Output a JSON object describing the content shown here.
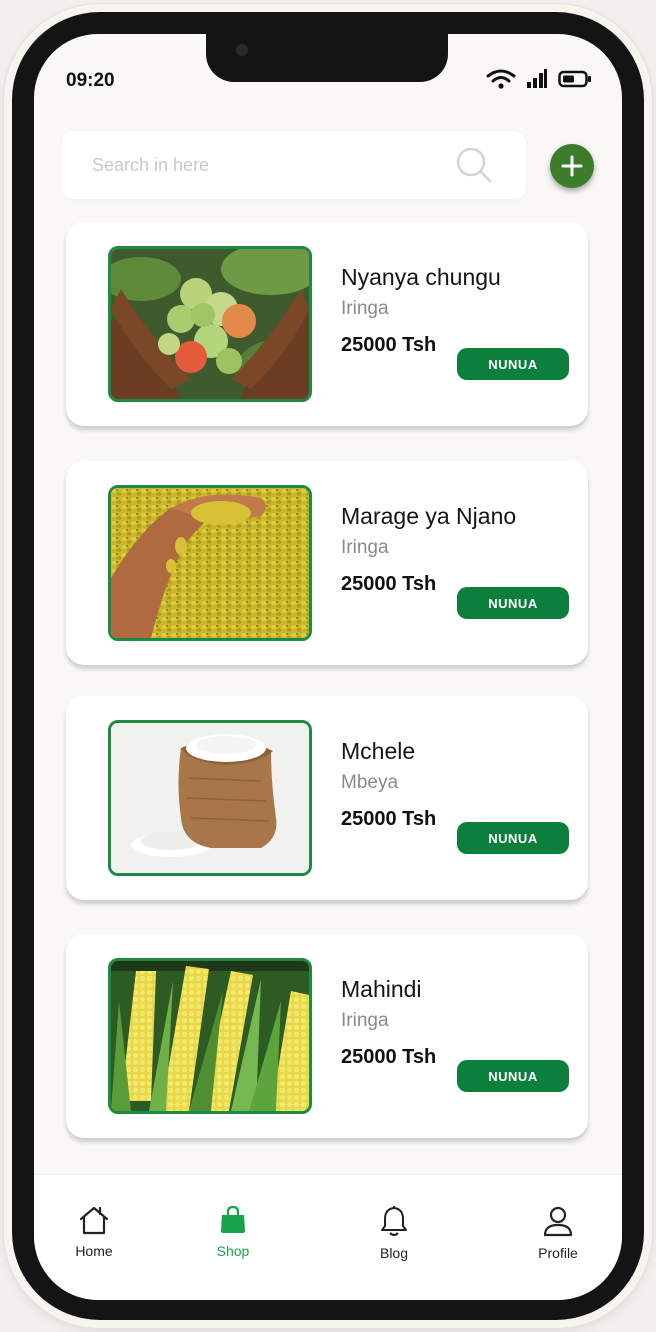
{
  "status": {
    "time": "09:20"
  },
  "search": {
    "placeholder": "Search in here"
  },
  "products": [
    {
      "name": "Nyanya chungu",
      "location": "Iringa",
      "price": "25000 Tsh",
      "button": "NUNUA",
      "image": "tomatoes-image"
    },
    {
      "name": "Marage ya Njano",
      "location": "Iringa",
      "price": "25000 Tsh",
      "button": "NUNUA",
      "image": "yellow-beans-image"
    },
    {
      "name": "Mchele",
      "location": "Mbeya",
      "price": "25000 Tsh",
      "button": "NUNUA",
      "image": "rice-sack-image"
    },
    {
      "name": "Mahindi",
      "location": "Iringa",
      "price": "25000 Tsh",
      "button": "NUNUA",
      "image": "maize-image"
    }
  ],
  "nav": {
    "items": [
      {
        "label": "Home",
        "icon": "home-icon",
        "active": false
      },
      {
        "label": "Shop",
        "icon": "shopping-bag-icon",
        "active": true
      },
      {
        "label": "Blog",
        "icon": "bell-icon",
        "active": false
      },
      {
        "label": "Profile",
        "icon": "user-icon",
        "active": false
      }
    ]
  },
  "colors": {
    "accent": "#0c7f3d",
    "add_button": "#3b7d2a",
    "active_nav": "#17a34a",
    "image_border": "#1f8a44"
  }
}
